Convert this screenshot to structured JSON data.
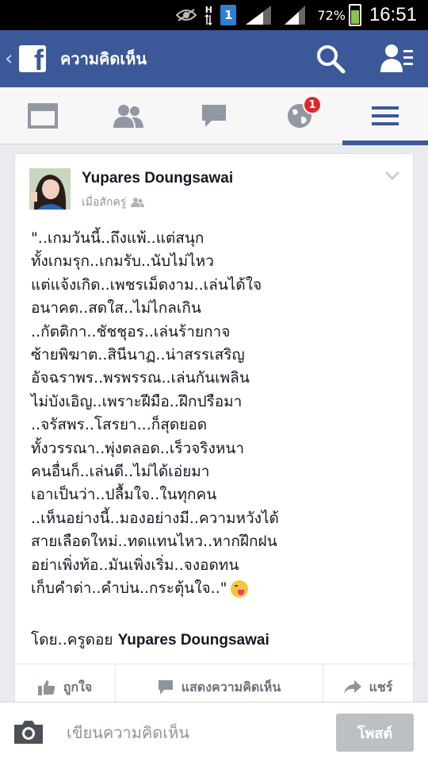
{
  "status_bar": {
    "network_type": "H",
    "sim_slot": "1",
    "battery_percent": "72%",
    "battery_level": 0.72,
    "time": "16:51",
    "icons": [
      "eye-icon",
      "data-arrows-icon",
      "sim-icon",
      "signal-icon",
      "battery-icon"
    ]
  },
  "header": {
    "title": "ความคิดเห็น",
    "logo_letter": "f",
    "bg_color": "#3b5998"
  },
  "tabs": [
    {
      "name": "news-feed",
      "icon": "news-feed-icon"
    },
    {
      "name": "friend-requests",
      "icon": "friends-icon"
    },
    {
      "name": "messages",
      "icon": "chat-bubble-icon"
    },
    {
      "name": "notifications",
      "icon": "globe-icon",
      "badge": "1"
    },
    {
      "name": "more",
      "icon": "menu-icon",
      "active": true
    }
  ],
  "post": {
    "author": "Yupares Doungsawai",
    "timestamp": "เมื่อสักครู่",
    "lines": [
      "\"..เกมวันนี้..ถึงแพ้..แต่สนุก",
      "ทั้งเกมรุก..เกมรับ..นับไม่ไหว",
      "แต่แจ้งเกิด..เพชรเม็ดงาม..เล่นได้ใจ",
      "อนาคต..สดใส..ไม่ไกลเกิน",
      "..กัตติกา..ชัชชุอร..เล่นร้ายกาจ",
      "ซ้ายพิฆาต..สินีนาฏ..น่าสรรเสริญ",
      "อัจฉราพร..พรพรรณ..เล่นกันเพลิน",
      "ไม่บังเอิญ..เพราะฝีมือ..ฝึกปรือมา",
      "..จรัสพร..โสรยา...ก็สุดยอด",
      "ทั้งวรรณา..พุ่งตลอด..เร็วจริงหนา",
      "คนอื่นก็..เล่นดี..ไม่ได้เอ่ยมา",
      "เอาเป็นว่า..ปลื้มใจ..ในทุกคน",
      "..เห็นอย่างนี้..มองอย่างมี..ความหวังได้",
      "สายเลือดใหม่..ทดแทนไหว..หากฝึกฝน",
      "อย่าเพิ่งท้อ..มันเพิ่งเริ่ม..จงอดทน",
      "เก็บคำด่า..คำบ่น..กระตุ้นใจ..\""
    ],
    "byline_prefix": "โดย..ครูดอย",
    "byline_name": "Yupares Doungsawai"
  },
  "actions": {
    "like": "ถูกใจ",
    "comment": "แสดงความคิดเห็น",
    "share": "แชร์"
  },
  "composer": {
    "placeholder": "เขียนความคิดเห็น",
    "post_button": "โพสต์"
  }
}
